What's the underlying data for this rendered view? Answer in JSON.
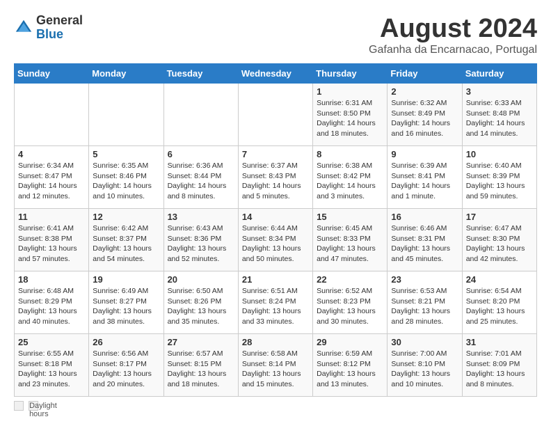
{
  "header": {
    "logo_general": "General",
    "logo_blue": "Blue",
    "month_title": "August 2024",
    "location": "Gafanha da Encarnacao, Portugal"
  },
  "weekdays": [
    "Sunday",
    "Monday",
    "Tuesday",
    "Wednesday",
    "Thursday",
    "Friday",
    "Saturday"
  ],
  "weeks": [
    [
      {
        "day": "",
        "info": ""
      },
      {
        "day": "",
        "info": ""
      },
      {
        "day": "",
        "info": ""
      },
      {
        "day": "",
        "info": ""
      },
      {
        "day": "1",
        "info": "Sunrise: 6:31 AM\nSunset: 8:50 PM\nDaylight: 14 hours\nand 18 minutes."
      },
      {
        "day": "2",
        "info": "Sunrise: 6:32 AM\nSunset: 8:49 PM\nDaylight: 14 hours\nand 16 minutes."
      },
      {
        "day": "3",
        "info": "Sunrise: 6:33 AM\nSunset: 8:48 PM\nDaylight: 14 hours\nand 14 minutes."
      }
    ],
    [
      {
        "day": "4",
        "info": "Sunrise: 6:34 AM\nSunset: 8:47 PM\nDaylight: 14 hours\nand 12 minutes."
      },
      {
        "day": "5",
        "info": "Sunrise: 6:35 AM\nSunset: 8:46 PM\nDaylight: 14 hours\nand 10 minutes."
      },
      {
        "day": "6",
        "info": "Sunrise: 6:36 AM\nSunset: 8:44 PM\nDaylight: 14 hours\nand 8 minutes."
      },
      {
        "day": "7",
        "info": "Sunrise: 6:37 AM\nSunset: 8:43 PM\nDaylight: 14 hours\nand 5 minutes."
      },
      {
        "day": "8",
        "info": "Sunrise: 6:38 AM\nSunset: 8:42 PM\nDaylight: 14 hours\nand 3 minutes."
      },
      {
        "day": "9",
        "info": "Sunrise: 6:39 AM\nSunset: 8:41 PM\nDaylight: 14 hours\nand 1 minute."
      },
      {
        "day": "10",
        "info": "Sunrise: 6:40 AM\nSunset: 8:39 PM\nDaylight: 13 hours\nand 59 minutes."
      }
    ],
    [
      {
        "day": "11",
        "info": "Sunrise: 6:41 AM\nSunset: 8:38 PM\nDaylight: 13 hours\nand 57 minutes."
      },
      {
        "day": "12",
        "info": "Sunrise: 6:42 AM\nSunset: 8:37 PM\nDaylight: 13 hours\nand 54 minutes."
      },
      {
        "day": "13",
        "info": "Sunrise: 6:43 AM\nSunset: 8:36 PM\nDaylight: 13 hours\nand 52 minutes."
      },
      {
        "day": "14",
        "info": "Sunrise: 6:44 AM\nSunset: 8:34 PM\nDaylight: 13 hours\nand 50 minutes."
      },
      {
        "day": "15",
        "info": "Sunrise: 6:45 AM\nSunset: 8:33 PM\nDaylight: 13 hours\nand 47 minutes."
      },
      {
        "day": "16",
        "info": "Sunrise: 6:46 AM\nSunset: 8:31 PM\nDaylight: 13 hours\nand 45 minutes."
      },
      {
        "day": "17",
        "info": "Sunrise: 6:47 AM\nSunset: 8:30 PM\nDaylight: 13 hours\nand 42 minutes."
      }
    ],
    [
      {
        "day": "18",
        "info": "Sunrise: 6:48 AM\nSunset: 8:29 PM\nDaylight: 13 hours\nand 40 minutes."
      },
      {
        "day": "19",
        "info": "Sunrise: 6:49 AM\nSunset: 8:27 PM\nDaylight: 13 hours\nand 38 minutes."
      },
      {
        "day": "20",
        "info": "Sunrise: 6:50 AM\nSunset: 8:26 PM\nDaylight: 13 hours\nand 35 minutes."
      },
      {
        "day": "21",
        "info": "Sunrise: 6:51 AM\nSunset: 8:24 PM\nDaylight: 13 hours\nand 33 minutes."
      },
      {
        "day": "22",
        "info": "Sunrise: 6:52 AM\nSunset: 8:23 PM\nDaylight: 13 hours\nand 30 minutes."
      },
      {
        "day": "23",
        "info": "Sunrise: 6:53 AM\nSunset: 8:21 PM\nDaylight: 13 hours\nand 28 minutes."
      },
      {
        "day": "24",
        "info": "Sunrise: 6:54 AM\nSunset: 8:20 PM\nDaylight: 13 hours\nand 25 minutes."
      }
    ],
    [
      {
        "day": "25",
        "info": "Sunrise: 6:55 AM\nSunset: 8:18 PM\nDaylight: 13 hours\nand 23 minutes."
      },
      {
        "day": "26",
        "info": "Sunrise: 6:56 AM\nSunset: 8:17 PM\nDaylight: 13 hours\nand 20 minutes."
      },
      {
        "day": "27",
        "info": "Sunrise: 6:57 AM\nSunset: 8:15 PM\nDaylight: 13 hours\nand 18 minutes."
      },
      {
        "day": "28",
        "info": "Sunrise: 6:58 AM\nSunset: 8:14 PM\nDaylight: 13 hours\nand 15 minutes."
      },
      {
        "day": "29",
        "info": "Sunrise: 6:59 AM\nSunset: 8:12 PM\nDaylight: 13 hours\nand 13 minutes."
      },
      {
        "day": "30",
        "info": "Sunrise: 7:00 AM\nSunset: 8:10 PM\nDaylight: 13 hours\nand 10 minutes."
      },
      {
        "day": "31",
        "info": "Sunrise: 7:01 AM\nSunset: 8:09 PM\nDaylight: 13 hours\nand 8 minutes."
      }
    ]
  ],
  "footer": {
    "daylight_label": "Daylight hours"
  }
}
